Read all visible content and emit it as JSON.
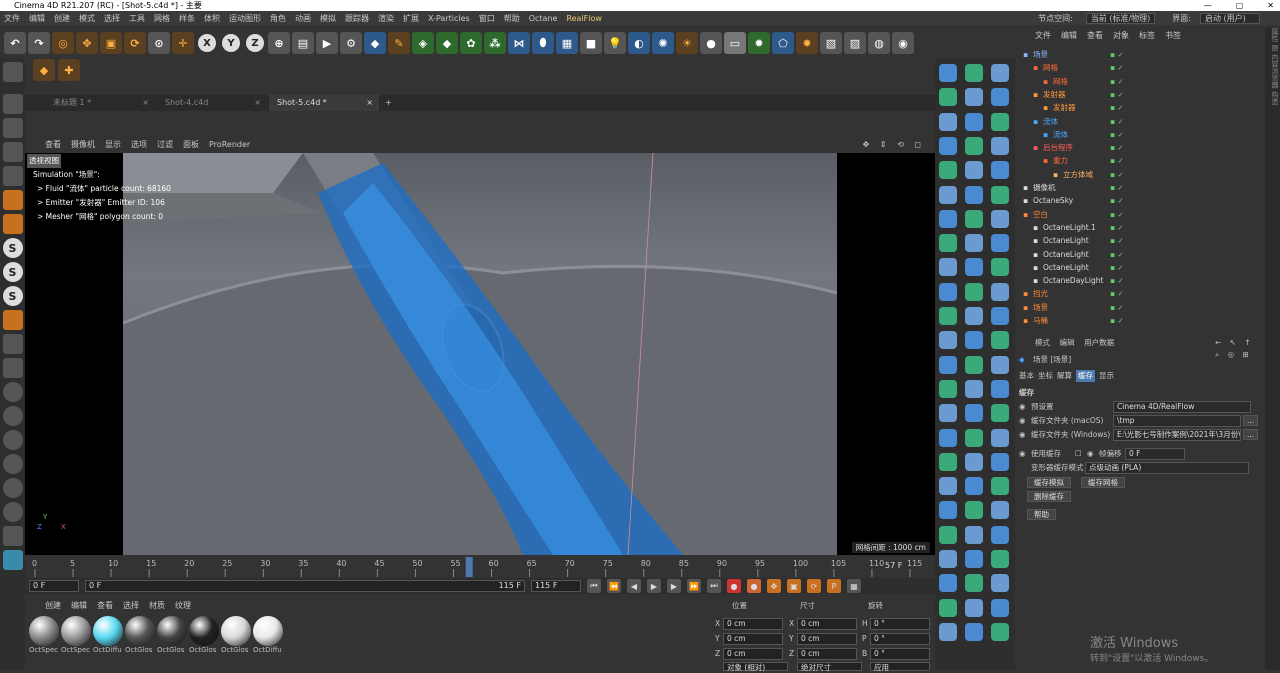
{
  "window": {
    "title": "Cinema 4D R21.207 (RC) - [Shot-5.c4d *] - 主要",
    "controls": [
      "—",
      "▢",
      "✕"
    ]
  },
  "menu": {
    "items": [
      "文件",
      "编辑",
      "创建",
      "模式",
      "选择",
      "工具",
      "网格",
      "样条",
      "体积",
      "运动图形",
      "角色",
      "动画",
      "模拟",
      "跟踪器",
      "渲染",
      "扩展",
      "X-Particles",
      "窗口",
      "帮助",
      "Octane",
      "RealFlow"
    ],
    "node_space_label": "节点空间:",
    "node_space_value": "当前 (标准/物理)",
    "layout_label": "界面:",
    "layout_value": "启动 (用户)"
  },
  "toolbar": {
    "axis": [
      "X",
      "Y",
      "Z"
    ]
  },
  "left_tools": {
    "s_labels": [
      "S",
      "S",
      "S"
    ]
  },
  "tabs": [
    {
      "label": "未标题 1 *"
    },
    {
      "label": "Shot-4.c4d"
    },
    {
      "label": "Shot-5.c4d *"
    }
  ],
  "tab_add": "+",
  "viewport": {
    "menu": [
      "查看",
      "摄像机",
      "显示",
      "选项",
      "过滤",
      "面板",
      "ProRender"
    ],
    "nav_icons": "✥ ⇕ ⟲ ◻",
    "view_name": "透视视图",
    "hud": [
      "Simulation \"场景\":",
      "> Fluid \"流体\" particle count: 68160",
      "> Emitter \"发射器\" Emitter ID: 106",
      "> Mesher \"网格\" polygon count: 0"
    ],
    "grid_spacing": "网格间距 : 1000 cm",
    "axis_x": "X",
    "axis_y": "Y",
    "axis_z": "Z"
  },
  "timeline": {
    "ticks": [
      "0",
      "5",
      "10",
      "15",
      "20",
      "25",
      "30",
      "35",
      "40",
      "45",
      "50",
      "55",
      "60",
      "65",
      "70",
      "75",
      "80",
      "85",
      "90",
      "95",
      "100",
      "105",
      "110",
      "115"
    ],
    "current_marker": "57",
    "current_frame": "57 F",
    "start": "0 F",
    "start2": "0 F",
    "end": "115 F",
    "end2": "115 F",
    "play_icons": [
      "⏮",
      "⏪",
      "◀",
      "▶",
      "▶",
      "⏩",
      "⏭"
    ]
  },
  "material_manager": {
    "menu": [
      "创建",
      "编辑",
      "查看",
      "选择",
      "材质",
      "纹理"
    ],
    "materials": [
      {
        "label": "OctSpec",
        "color": "#8a8a8a"
      },
      {
        "label": "OctSpec",
        "color": "#9a9a9a"
      },
      {
        "label": "OctDiffu",
        "color": "#5ad8f0"
      },
      {
        "label": "OctGlos",
        "color": "#555"
      },
      {
        "label": "OctGlos",
        "color": "#444"
      },
      {
        "label": "OctGlos",
        "color": "#222"
      },
      {
        "label": "OctGlos",
        "color": "#d8d8d8"
      },
      {
        "label": "OctDiffu",
        "color": "#e8e8e8"
      }
    ]
  },
  "coordinates": {
    "headers": [
      "位置",
      "尺寸",
      "旋转"
    ],
    "rows": [
      {
        "pos_axis": "X",
        "pos": "0 cm",
        "size_axis": "X",
        "size": "0 cm",
        "rot_axis": "H",
        "rot": "0 °"
      },
      {
        "pos_axis": "Y",
        "pos": "0 cm",
        "size_axis": "Y",
        "size": "0 cm",
        "rot_axis": "P",
        "rot": "0 °"
      },
      {
        "pos_axis": "Z",
        "pos": "0 cm",
        "size_axis": "Z",
        "size": "0 cm",
        "rot_axis": "B",
        "rot": "0 °"
      }
    ],
    "mode_object": "对象 (相对)",
    "mode_size": "绝对尺寸",
    "apply": "应用"
  },
  "object_manager": {
    "menu": [
      "文件",
      "编辑",
      "查看",
      "对象",
      "标签",
      "书签"
    ],
    "objects": [
      {
        "name": "场景",
        "color": "#8ab8ff",
        "depth": 0
      },
      {
        "name": "网格",
        "color": "#ff6a3a",
        "depth": 1
      },
      {
        "name": "网格",
        "color": "#ff6a3a",
        "depth": 2
      },
      {
        "name": "发射器",
        "color": "#ff9a3a",
        "depth": 1
      },
      {
        "name": "发射器",
        "color": "#ff9a3a",
        "depth": 2
      },
      {
        "name": "流体",
        "color": "#4aa8ff",
        "depth": 1
      },
      {
        "name": "流体",
        "color": "#4aa8ff",
        "depth": 2
      },
      {
        "name": "后台程序",
        "color": "#ff5a5a",
        "depth": 1
      },
      {
        "name": "重力",
        "color": "#ff6a3a",
        "depth": 2
      },
      {
        "name": "立方体域",
        "color": "#ffb060",
        "depth": 3
      },
      {
        "name": "摄像机",
        "color": "#ddd",
        "depth": 0
      },
      {
        "name": "OctaneSky",
        "color": "#ddd",
        "depth": 0
      },
      {
        "name": "空白",
        "color": "#ff8a3a",
        "depth": 0
      },
      {
        "name": "OctaneLight.1",
        "color": "#ddd",
        "depth": 1
      },
      {
        "name": "OctaneLight",
        "color": "#ddd",
        "depth": 1
      },
      {
        "name": "OctaneLight",
        "color": "#ddd",
        "depth": 1
      },
      {
        "name": "OctaneLight",
        "color": "#ddd",
        "depth": 1
      },
      {
        "name": "OctaneDayLight",
        "color": "#ddd",
        "depth": 1
      },
      {
        "name": "挡光",
        "color": "#ff8a3a",
        "depth": 0
      },
      {
        "name": "场景",
        "color": "#ff8a3a",
        "depth": 0
      },
      {
        "name": "马桶",
        "color": "#ff8a3a",
        "depth": 0
      }
    ]
  },
  "attribute_manager": {
    "menu": [
      "模式",
      "编辑",
      "用户数据"
    ],
    "object_title": "场景 [场景]",
    "tabs": [
      "基本",
      "坐标",
      "解算",
      "缓存",
      "显示"
    ],
    "active_tab": "缓存",
    "section": "缓存",
    "fields": [
      {
        "label": "预设置",
        "value": "Cinema 4D/RealFlow"
      },
      {
        "label": "缓存文件夹 (macOS)",
        "value": "\\tmp"
      },
      {
        "label": "缓存文件夹 (Windows)",
        "value": "E:\\光影七号制作案例\\2021年\\3月份\\"
      }
    ],
    "use_cache_label": "使用缓存",
    "frame_offset_label": "帧偏移",
    "frame_offset": "0 F",
    "deformer_label": "变形器缓存模式",
    "deformer_value": "点级动画 (PLA)",
    "buttons": [
      "缓存模拟",
      "缓存网格",
      "删除缓存",
      "帮助"
    ]
  },
  "right_strip": "属性 层 内容浏览器 构造",
  "watermark": {
    "line1": "激活 Windows",
    "line2": "转到\"设置\"以激活 Windows。"
  }
}
